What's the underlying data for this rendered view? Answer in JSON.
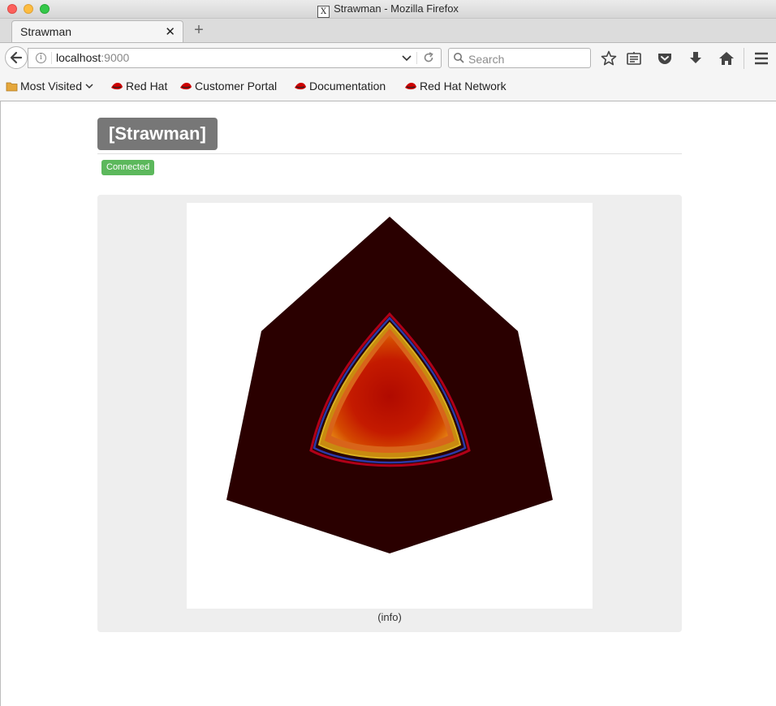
{
  "window": {
    "title": "Strawman - Mozilla Firefox"
  },
  "tab": {
    "label": "Strawman"
  },
  "url": {
    "host": "localhost",
    "port": ":9000"
  },
  "search": {
    "placeholder": "Search"
  },
  "bookmarks": [
    {
      "label": "Most Visited"
    },
    {
      "label": "Red Hat"
    },
    {
      "label": "Customer Portal"
    },
    {
      "label": "Documentation"
    },
    {
      "label": "Red Hat Network"
    }
  ],
  "page": {
    "brand": "[Strawman]",
    "status": "Connected",
    "info_link": "(info)"
  },
  "colors": {
    "status_green": "#5cb85c",
    "brand_gray": "#777777",
    "render_background": "#2a0000",
    "render_core": "#c01000"
  }
}
